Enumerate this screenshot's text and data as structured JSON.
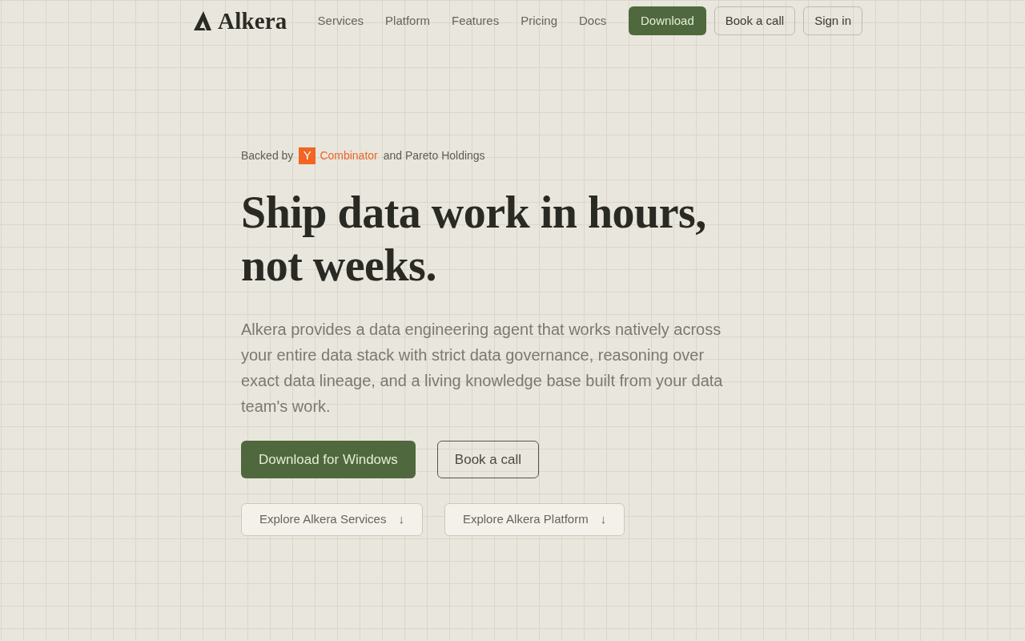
{
  "header": {
    "logo": {
      "text": "Alkera"
    },
    "nav": [
      {
        "label": "Services"
      },
      {
        "label": "Platform"
      },
      {
        "label": "Features"
      },
      {
        "label": "Pricing"
      },
      {
        "label": "Docs"
      }
    ],
    "actions": [
      {
        "label": "Download",
        "kind": "primary"
      },
      {
        "label": "Book a call",
        "kind": "outline"
      },
      {
        "label": "Sign in",
        "kind": "outline"
      }
    ]
  },
  "hero": {
    "backing": {
      "prefix": "Backed by",
      "badge": "Y",
      "brand": "Combinator",
      "suffix": "and Pareto Holdings"
    },
    "headline": "Ship data work in hours, not weeks.",
    "description": "Alkera provides a data engineering agent that works natively across your entire data stack with strict data governance, reasoning over exact data lineage, and a living knowledge base built from your data team's work.",
    "cta": [
      {
        "label": "Download for Windows",
        "kind": "primary"
      },
      {
        "label": "Book a call",
        "kind": "outline"
      }
    ],
    "explore": [
      {
        "label": "Explore Alkera Services",
        "arrow": "↓"
      },
      {
        "label": "Explore Alkera Platform",
        "arrow": "↓"
      }
    ]
  }
}
